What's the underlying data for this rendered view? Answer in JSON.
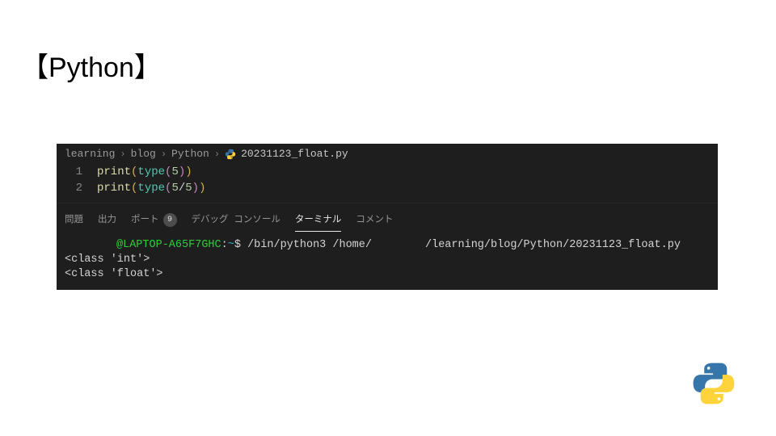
{
  "title": {
    "open": "【",
    "text": "Python",
    "close": "】"
  },
  "breadcrumb": {
    "seg1": "learning",
    "seg2": "blog",
    "seg3": "Python",
    "file": "20231123_float.py"
  },
  "code": {
    "lines": [
      {
        "num": "1",
        "fn": "print",
        "call": "type",
        "arg_a": "5",
        "op": "",
        "arg_b": ""
      },
      {
        "num": "2",
        "fn": "print",
        "call": "type",
        "arg_a": "5",
        "op": "/",
        "arg_b": "5"
      }
    ]
  },
  "panel": {
    "tab_problems": "問題",
    "tab_output": "出力",
    "tab_ports": "ポート",
    "badge_ports": "9",
    "tab_debug": "デバッグ コンソール",
    "tab_terminal": "ターミナル",
    "tab_comments": "コメント"
  },
  "terminal": {
    "host": "@LAPTOP-A65F7GHC",
    "colon": ":",
    "cwd": "~",
    "prompt": "$",
    "cmd_a": "/bin/python3 /home/",
    "cmd_b": "/learning/blog/Python/20231123_float.py",
    "out1": "<class 'int'>",
    "out2": "<class 'float'>"
  }
}
